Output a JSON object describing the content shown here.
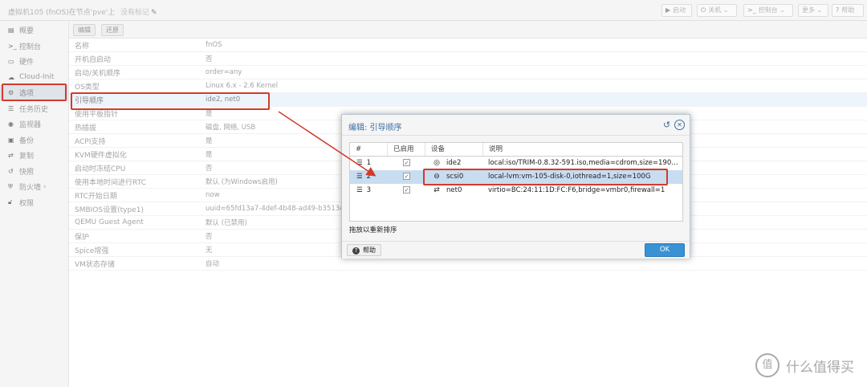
{
  "window": {
    "title": "虚拟机105 (fnOS)在节点'pve'上",
    "tags": "没有标记",
    "tags_icon": "pencil-icon"
  },
  "toolbar": {
    "start": "启动",
    "shutdown": "关机",
    "console": "控制台",
    "more": "更多",
    "help": "帮助"
  },
  "sidebar": {
    "items": [
      {
        "label": "概要",
        "icon": "book-icon"
      },
      {
        "label": "控制台",
        "icon": "terminal-icon"
      },
      {
        "label": "硬件",
        "icon": "monitor-icon"
      },
      {
        "label": "Cloud-Init",
        "icon": "cloud-icon"
      },
      {
        "label": "选项",
        "icon": "gear-icon"
      },
      {
        "label": "任务历史",
        "icon": "list-icon"
      },
      {
        "label": "监视器",
        "icon": "eye-icon"
      },
      {
        "label": "备份",
        "icon": "floppy-icon"
      },
      {
        "label": "复制",
        "icon": "retweet-icon"
      },
      {
        "label": "快照",
        "icon": "history-icon"
      },
      {
        "label": "防火墙",
        "icon": "shield-icon"
      },
      {
        "label": "权限",
        "icon": "unlock-icon"
      }
    ]
  },
  "content_toolbar": {
    "edit": "编辑",
    "revert": "还原"
  },
  "options": [
    {
      "key": "名称",
      "value": "fnOS"
    },
    {
      "key": "开机自启动",
      "value": "否"
    },
    {
      "key": "启动/关机顺序",
      "value": "order=any"
    },
    {
      "key": "OS类型",
      "value": "Linux 6.x - 2.6 Kernel"
    },
    {
      "key": "引导顺序",
      "value": "ide2, net0"
    },
    {
      "key": "使用平板指针",
      "value": "是"
    },
    {
      "key": "热插拔",
      "value": "磁盘, 网络, USB"
    },
    {
      "key": "ACPI支持",
      "value": "是"
    },
    {
      "key": "KVM硬件虚拟化",
      "value": "是"
    },
    {
      "key": "启动时冻结CPU",
      "value": "否"
    },
    {
      "key": "使用本地时间进行RTC",
      "value": "默认 (为Windows启用)"
    },
    {
      "key": "RTC开始日期",
      "value": "now"
    },
    {
      "key": "SMBIOS设置(type1)",
      "value": "uuid=65fd13a7-4def-4b48-ad49-b3513ec8"
    },
    {
      "key": "QEMU Guest Agent",
      "value": "默认 (已禁用)"
    },
    {
      "key": "保护",
      "value": "否"
    },
    {
      "key": "Spice增强",
      "value": "无"
    },
    {
      "key": "VM状态存储",
      "value": "自动"
    }
  ],
  "dialog": {
    "title": "编辑: 引导顺序",
    "columns": {
      "num": "#",
      "enabled": "已启用",
      "device": "设备",
      "desc": "说明"
    },
    "rows": [
      {
        "num": "1",
        "device": "ide2",
        "device_icon": "cdrom-icon",
        "desc": "local:iso/TRIM-0.8.32-591.iso,media=cdrom,size=19075…"
      },
      {
        "num": "2",
        "device": "scsi0",
        "device_icon": "harddisk-icon",
        "desc": "local-lvm:vm-105-disk-0,iothread=1,size=100G"
      },
      {
        "num": "3",
        "device": "net0",
        "device_icon": "exchange-icon",
        "desc": "virtio=BC:24:11:1D:FC:F6,bridge=vmbr0,firewall=1"
      }
    ],
    "hint": "拖放以重新排序",
    "help": "帮助",
    "ok": "OK"
  },
  "watermark": {
    "text": "什么值得买",
    "logo": "值"
  },
  "colors": {
    "accent": "#3892d4",
    "annotation": "#d33a2c",
    "title_blue": "#3b6fa3"
  }
}
